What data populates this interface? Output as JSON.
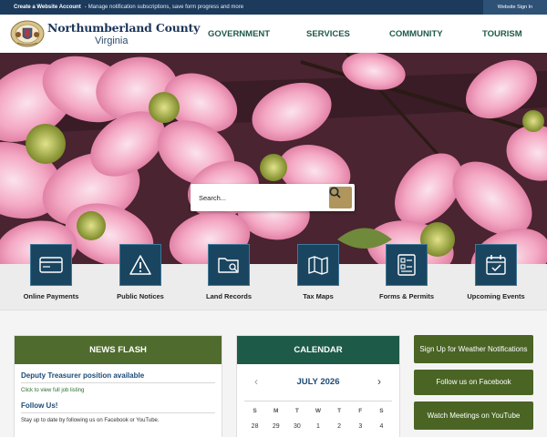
{
  "topbar": {
    "create_label": "Create a Website Account",
    "separator": "-",
    "description": "Manage notification subscriptions, save form progress and more",
    "signin_label": "Website Sign In"
  },
  "header": {
    "county_name": "Northumberland County",
    "state_name": "Virginia"
  },
  "nav": {
    "government": "GOVERNMENT",
    "services": "SERVICES",
    "community": "COMMUNITY",
    "tourism": "TOURISM"
  },
  "search": {
    "placeholder": "Search..."
  },
  "quick_links": [
    {
      "label": "Online Payments",
      "icon": "credit-card-icon"
    },
    {
      "label": "Public Notices",
      "icon": "warning-icon"
    },
    {
      "label": "Land Records",
      "icon": "folder-search-icon"
    },
    {
      "label": "Tax Maps",
      "icon": "map-icon"
    },
    {
      "label": "Forms & Permits",
      "icon": "forms-icon"
    },
    {
      "label": "Upcoming Events",
      "icon": "calendar-icon"
    }
  ],
  "news_flash": {
    "heading": "NEWS FLASH",
    "items": [
      {
        "title": "Deputy Treasurer position available",
        "subtitle": "Click to view full job listing"
      },
      {
        "title": "Follow Us!",
        "subtitle": "Stay up to date by following us on Facebook or YouTube."
      }
    ]
  },
  "calendar": {
    "heading": "CALENDAR",
    "month": "JULY 2026",
    "prev_icon": "chevron-left-icon",
    "next_icon": "chevron-right-icon",
    "days_of_week": [
      "S",
      "M",
      "T",
      "W",
      "T",
      "F",
      "S"
    ],
    "first_row": [
      "28",
      "29",
      "30",
      "1",
      "2",
      "3",
      "4"
    ]
  },
  "side_buttons": {
    "weather": "Sign Up for Weather Notifications",
    "facebook": "Follow us on Facebook",
    "youtube": "Watch Meetings on YouTube"
  },
  "colors": {
    "topbar": "#1b3a5c",
    "nav_text": "#1e5a4a",
    "icon_box": "#1a4560",
    "news_header": "#4f6b2e",
    "calendar_header": "#1e5a48",
    "side_button": "#4a6424",
    "search_button": "#b0955c"
  }
}
